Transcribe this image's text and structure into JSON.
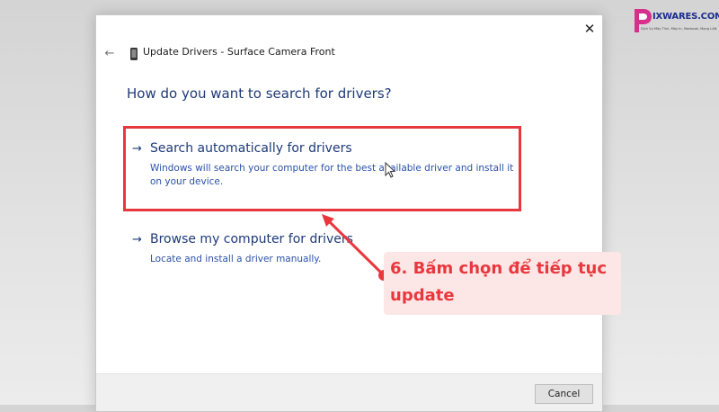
{
  "dialog": {
    "title": "Update Drivers - Surface Camera Front",
    "heading": "How do you want to search for drivers?",
    "close_glyph": "✕",
    "back_glyph": "←",
    "options": [
      {
        "arrow": "→",
        "title": "Search automatically for drivers",
        "description": "Windows will search your computer for the best available driver and install it on your device."
      },
      {
        "arrow": "→",
        "title": "Browse my computer for drivers",
        "description": "Locate and install a driver manually."
      }
    ],
    "cancel_label": "Cancel"
  },
  "annotation": {
    "text": "6. Bấm chọn để tiếp tục update",
    "color": "#e8383d",
    "background": "#fde6e6"
  },
  "logo": {
    "mark": "P",
    "name": "IXWARES.COM",
    "tagline": "Dịch Vụ Máy Tính, Máy In, Macbook, Mạng LAN"
  },
  "icons": {
    "device": "camera-device-icon",
    "cursor": "mouse-cursor-icon"
  }
}
